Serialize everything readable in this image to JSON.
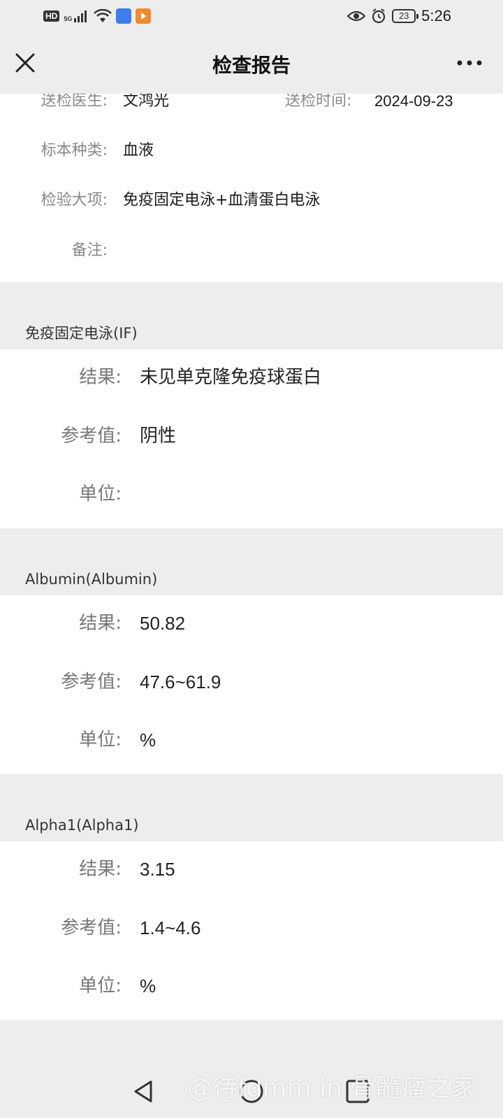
{
  "status_bar": {
    "hd": "HD",
    "network": "5G",
    "battery": "23",
    "time": "5:26"
  },
  "nav": {
    "title": "检查报告"
  },
  "info": {
    "doctor_label": "送检医生:",
    "doctor_value": "文鸿光",
    "time_label": "送检时间:",
    "time_value": "2024-09-23",
    "specimen_label": "标本种类:",
    "specimen_value": "血液",
    "item_label": "检验大项:",
    "item_value": "免疫固定电泳+血清蛋白电泳",
    "remark_label": "备注:",
    "remark_value": ""
  },
  "sections": [
    {
      "title": "免疫固定电泳(IF)",
      "result_label": "结果:",
      "result_value": "未见单克隆免疫球蛋白",
      "ref_label": "参考值:",
      "ref_value": "阴性",
      "unit_label": "单位:",
      "unit_value": ""
    },
    {
      "title": "Albumin(Albumin)",
      "result_label": "结果:",
      "result_value": "50.82",
      "ref_label": "参考值:",
      "ref_value": "47.6~61.9",
      "unit_label": "单位:",
      "unit_value": "%"
    },
    {
      "title": "Alpha1(Alpha1)",
      "result_label": "结果:",
      "result_value": "3.15",
      "ref_label": "参考值:",
      "ref_value": "1.4~4.6",
      "unit_label": "单位:",
      "unit_value": "%"
    }
  ],
  "watermark": "@待fdmm in 骨髓瘤之家"
}
